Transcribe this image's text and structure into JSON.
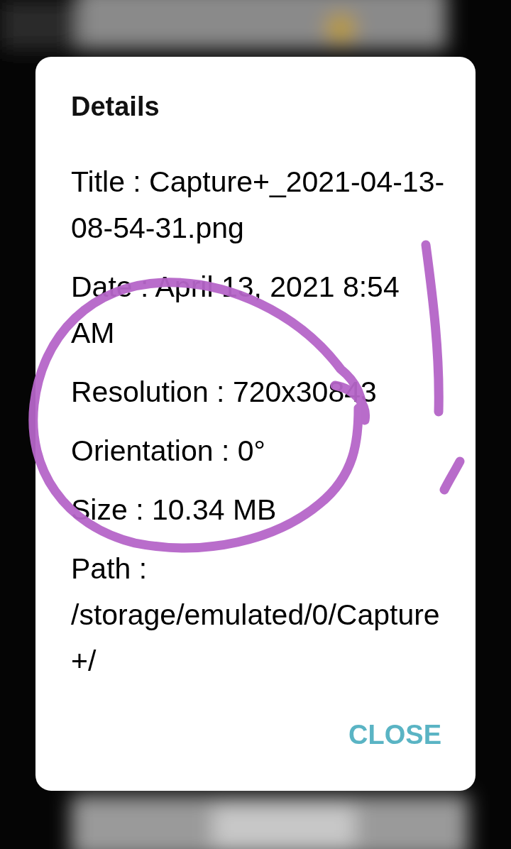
{
  "dialog": {
    "title": "Details",
    "details": [
      "Title : Capture+_2021-04-13-08-54-31.png",
      "Date : April 13, 2021 8:54 AM",
      "Resolution : 720x30843",
      "Orientation : 0°",
      "Size : 10.34 MB",
      "Path : /storage/emulated/0/Capture+/"
    ],
    "buttons": [
      "CLOSE"
    ]
  }
}
